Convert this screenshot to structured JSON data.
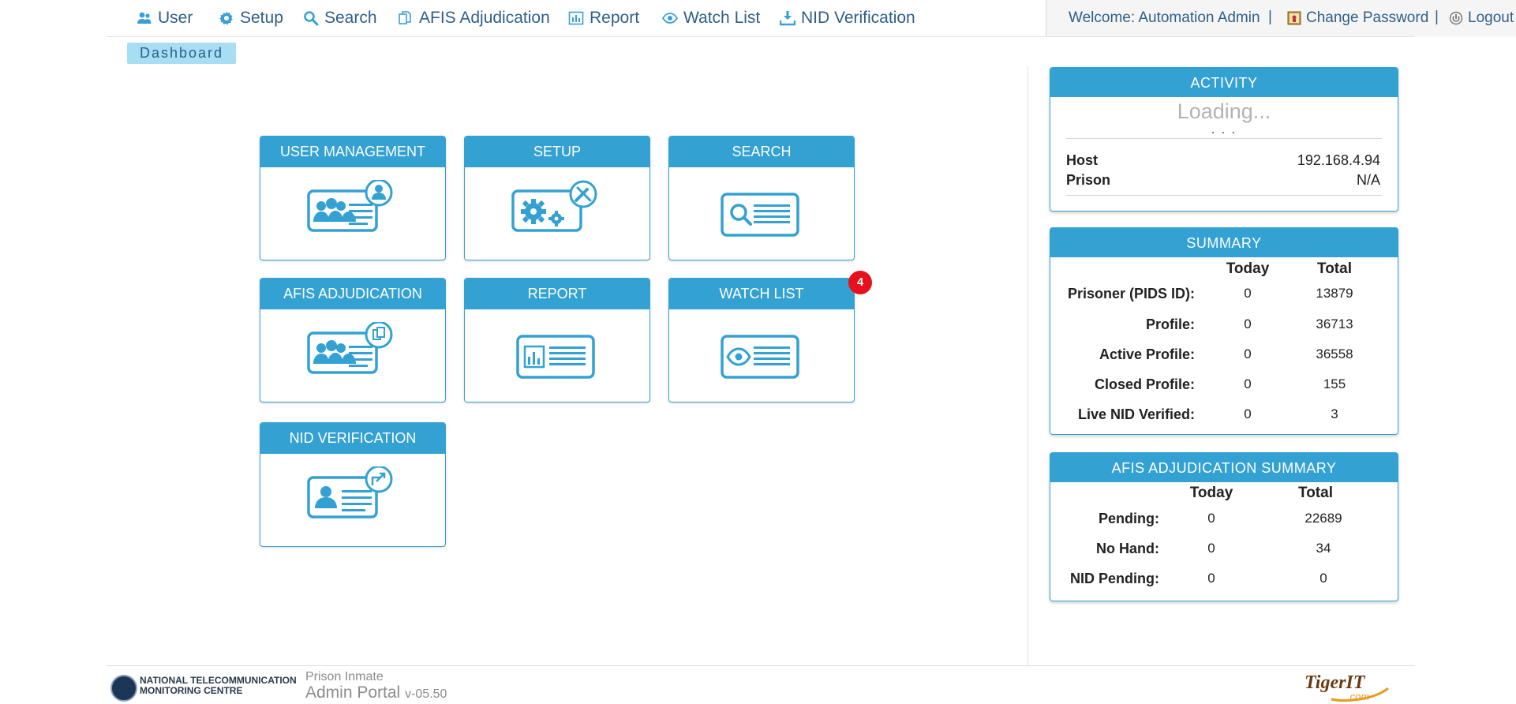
{
  "nav": {
    "items": [
      {
        "label": "User",
        "icon": "users-icon"
      },
      {
        "label": "Setup",
        "icon": "gear-icon"
      },
      {
        "label": "Search",
        "icon": "search-icon"
      },
      {
        "label": "AFIS Adjudication",
        "icon": "copy-icon"
      },
      {
        "label": "Report",
        "icon": "bar-chart-icon"
      },
      {
        "label": "Watch List",
        "icon": "eye-icon"
      },
      {
        "label": "NID Verification",
        "icon": "download-icon"
      }
    ]
  },
  "user": {
    "welcome": "Welcome: Automation Admin",
    "separator": "|",
    "change_password": "Change Password",
    "logout": "Logout"
  },
  "breadcrumb": "Dashboard",
  "tiles": [
    {
      "title": "USER MANAGEMENT",
      "icon": "user-management-card-icon"
    },
    {
      "title": "SETUP",
      "icon": "setup-card-icon"
    },
    {
      "title": "SEARCH",
      "icon": "search-card-icon"
    },
    {
      "title": "AFIS ADJUDICATION",
      "icon": "afis-card-icon"
    },
    {
      "title": "REPORT",
      "icon": "report-card-icon"
    },
    {
      "title": "WATCH LIST",
      "icon": "watchlist-card-icon",
      "badge": "4"
    },
    {
      "title": "NID VERIFICATION",
      "icon": "nid-card-icon"
    }
  ],
  "activity": {
    "title": "ACTIVITY",
    "loading": "Loading...",
    "dots": ". . .",
    "host_label": "Host",
    "host_value": "192.168.4.94",
    "prison_label": "Prison",
    "prison_value": "N/A"
  },
  "summary": {
    "title": "SUMMARY",
    "col_today": "Today",
    "col_total": "Total",
    "rows": [
      {
        "label": "Prisoner (PIDS ID):",
        "today": "0",
        "total": "13879"
      },
      {
        "label": "Profile:",
        "today": "0",
        "total": "36713"
      },
      {
        "label": "Active Profile:",
        "today": "0",
        "total": "36558"
      },
      {
        "label": "Closed Profile:",
        "today": "0",
        "total": "155"
      },
      {
        "label": "Live NID Verified:",
        "today": "0",
        "total": "3"
      }
    ]
  },
  "afis_summary": {
    "title": "AFIS ADJUDICATION SUMMARY",
    "col_today": "Today",
    "col_total": "Total",
    "rows": [
      {
        "label": "Pending:",
        "today": "0",
        "total": "22689"
      },
      {
        "label": "No Hand:",
        "today": "0",
        "total": "34"
      },
      {
        "label": "NID Pending:",
        "today": "0",
        "total": "0"
      }
    ]
  },
  "footer": {
    "org_line1": "NATIONAL TELECOMMUNICATION",
    "org_line2": "MONITORING CENTRE",
    "app_line1": "Prison Inmate",
    "app_line2": "Admin Portal",
    "version": "v-05.50",
    "vendor": "TigerIT",
    "vendor_suffix": ".com"
  },
  "colors": {
    "accent": "#34a1d3",
    "nav_text": "#2f5f86",
    "badge": "#e8101a",
    "crumb_bg": "#a8def4"
  }
}
